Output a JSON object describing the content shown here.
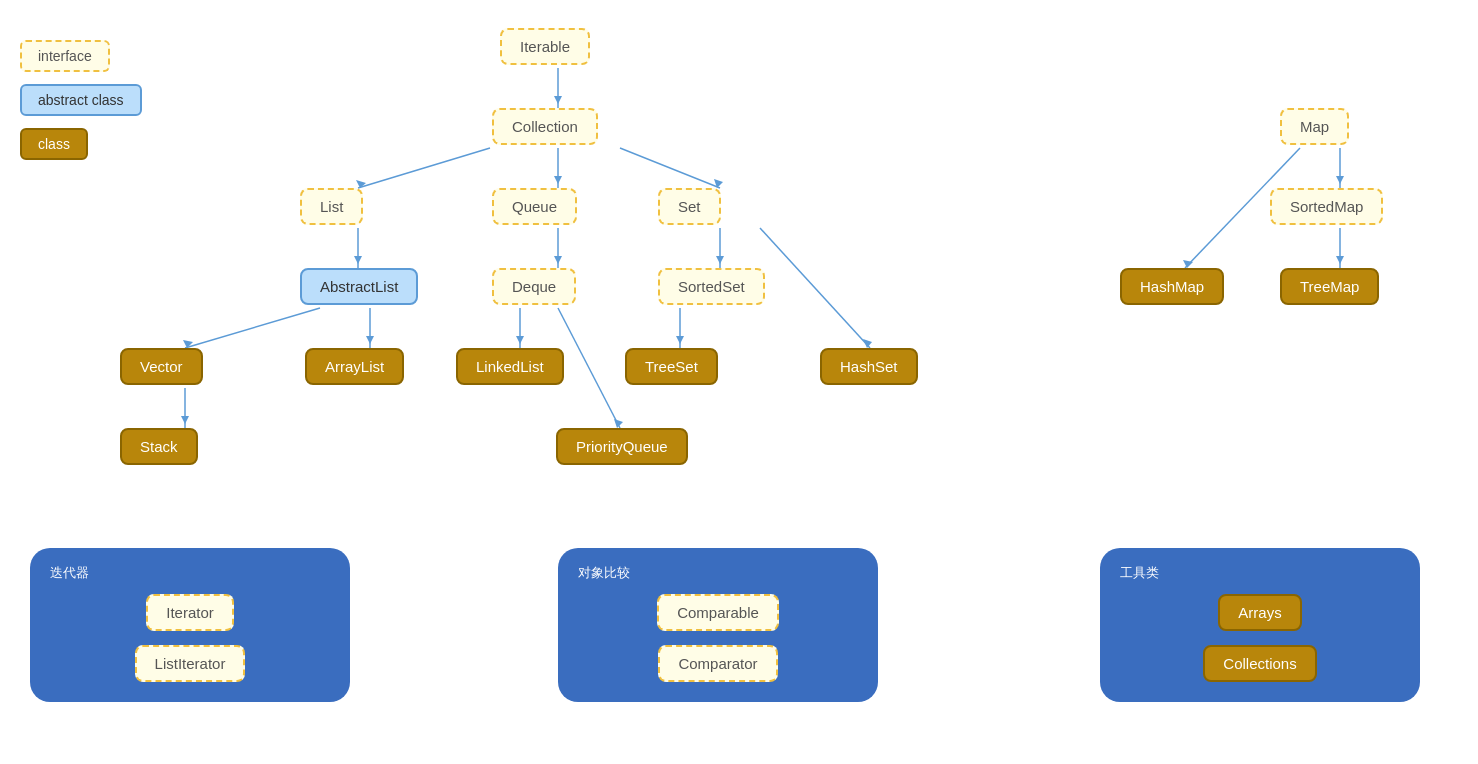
{
  "legend": {
    "items": [
      {
        "label": "interface",
        "type": "interface"
      },
      {
        "label": "abstract class",
        "type": "abstract"
      },
      {
        "label": "class",
        "type": "class"
      }
    ]
  },
  "nodes": {
    "iterable": {
      "label": "Iterable",
      "type": "interface"
    },
    "collection": {
      "label": "Collection",
      "type": "interface"
    },
    "list": {
      "label": "List",
      "type": "interface"
    },
    "queue": {
      "label": "Queue",
      "type": "interface"
    },
    "set": {
      "label": "Set",
      "type": "interface"
    },
    "abstractList": {
      "label": "AbstractList",
      "type": "abstract"
    },
    "deque": {
      "label": "Deque",
      "type": "interface"
    },
    "sortedSet": {
      "label": "SortedSet",
      "type": "interface"
    },
    "vector": {
      "label": "Vector",
      "type": "class"
    },
    "arrayList": {
      "label": "ArrayList",
      "type": "class"
    },
    "linkedList": {
      "label": "LinkedList",
      "type": "class"
    },
    "treeSet": {
      "label": "TreeSet",
      "type": "class"
    },
    "hashSet": {
      "label": "HashSet",
      "type": "class"
    },
    "stack": {
      "label": "Stack",
      "type": "class"
    },
    "priorityQueue": {
      "label": "PriorityQueue",
      "type": "class"
    },
    "map": {
      "label": "Map",
      "type": "interface"
    },
    "sortedMap": {
      "label": "SortedMap",
      "type": "interface"
    },
    "hashMap": {
      "label": "HashMap",
      "type": "class"
    },
    "treeMap": {
      "label": "TreeMap",
      "type": "class"
    }
  },
  "groups": [
    {
      "id": "iterators",
      "label": "迭代器",
      "items": [
        {
          "label": "Iterator",
          "type": "interface"
        },
        {
          "label": "ListIterator",
          "type": "interface"
        }
      ]
    },
    {
      "id": "comparators",
      "label": "对象比较",
      "items": [
        {
          "label": "Comparable",
          "type": "interface"
        },
        {
          "label": "Comparator",
          "type": "interface"
        }
      ]
    },
    {
      "id": "utilities",
      "label": "工具类",
      "items": [
        {
          "label": "Arrays",
          "type": "class"
        },
        {
          "label": "Collections",
          "type": "class"
        }
      ]
    }
  ]
}
